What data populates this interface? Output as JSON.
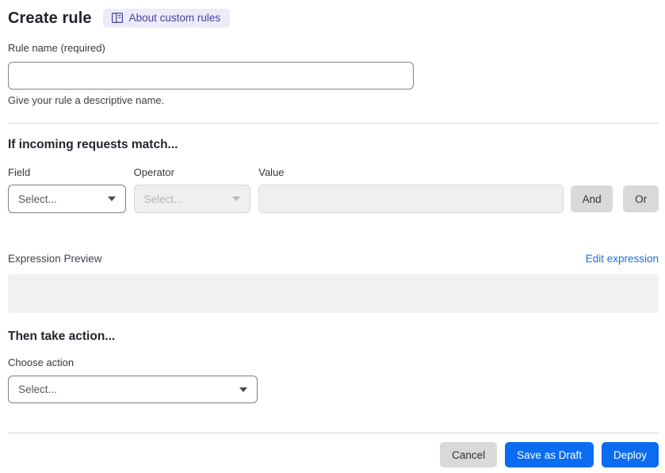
{
  "header": {
    "title": "Create rule",
    "badge": {
      "label": "About custom rules",
      "icon": "book-icon"
    }
  },
  "rule_name": {
    "label": "Rule name (required)",
    "value": "",
    "help": "Give your rule a descriptive name."
  },
  "match_section": {
    "heading": "If incoming requests match...",
    "field": {
      "label": "Field",
      "placeholder": "Select..."
    },
    "operator": {
      "label": "Operator",
      "placeholder": "Select..."
    },
    "value": {
      "label": "Value",
      "value": ""
    },
    "and_button": "And",
    "or_button": "Or"
  },
  "expression": {
    "label": "Expression Preview",
    "edit_link": "Edit expression",
    "value": ""
  },
  "action_section": {
    "heading": "Then take action...",
    "choose_label": "Choose action",
    "placeholder": "Select..."
  },
  "footer": {
    "cancel": "Cancel",
    "save_draft": "Save as Draft",
    "deploy": "Deploy"
  },
  "colors": {
    "primary_blue": "#0a6cf1",
    "link_blue": "#1b6fdc",
    "badge_bg": "#ecebf9",
    "badge_text": "#45429f",
    "disabled_bg": "#efefef",
    "neutral_button_bg": "#d9d9d9"
  }
}
